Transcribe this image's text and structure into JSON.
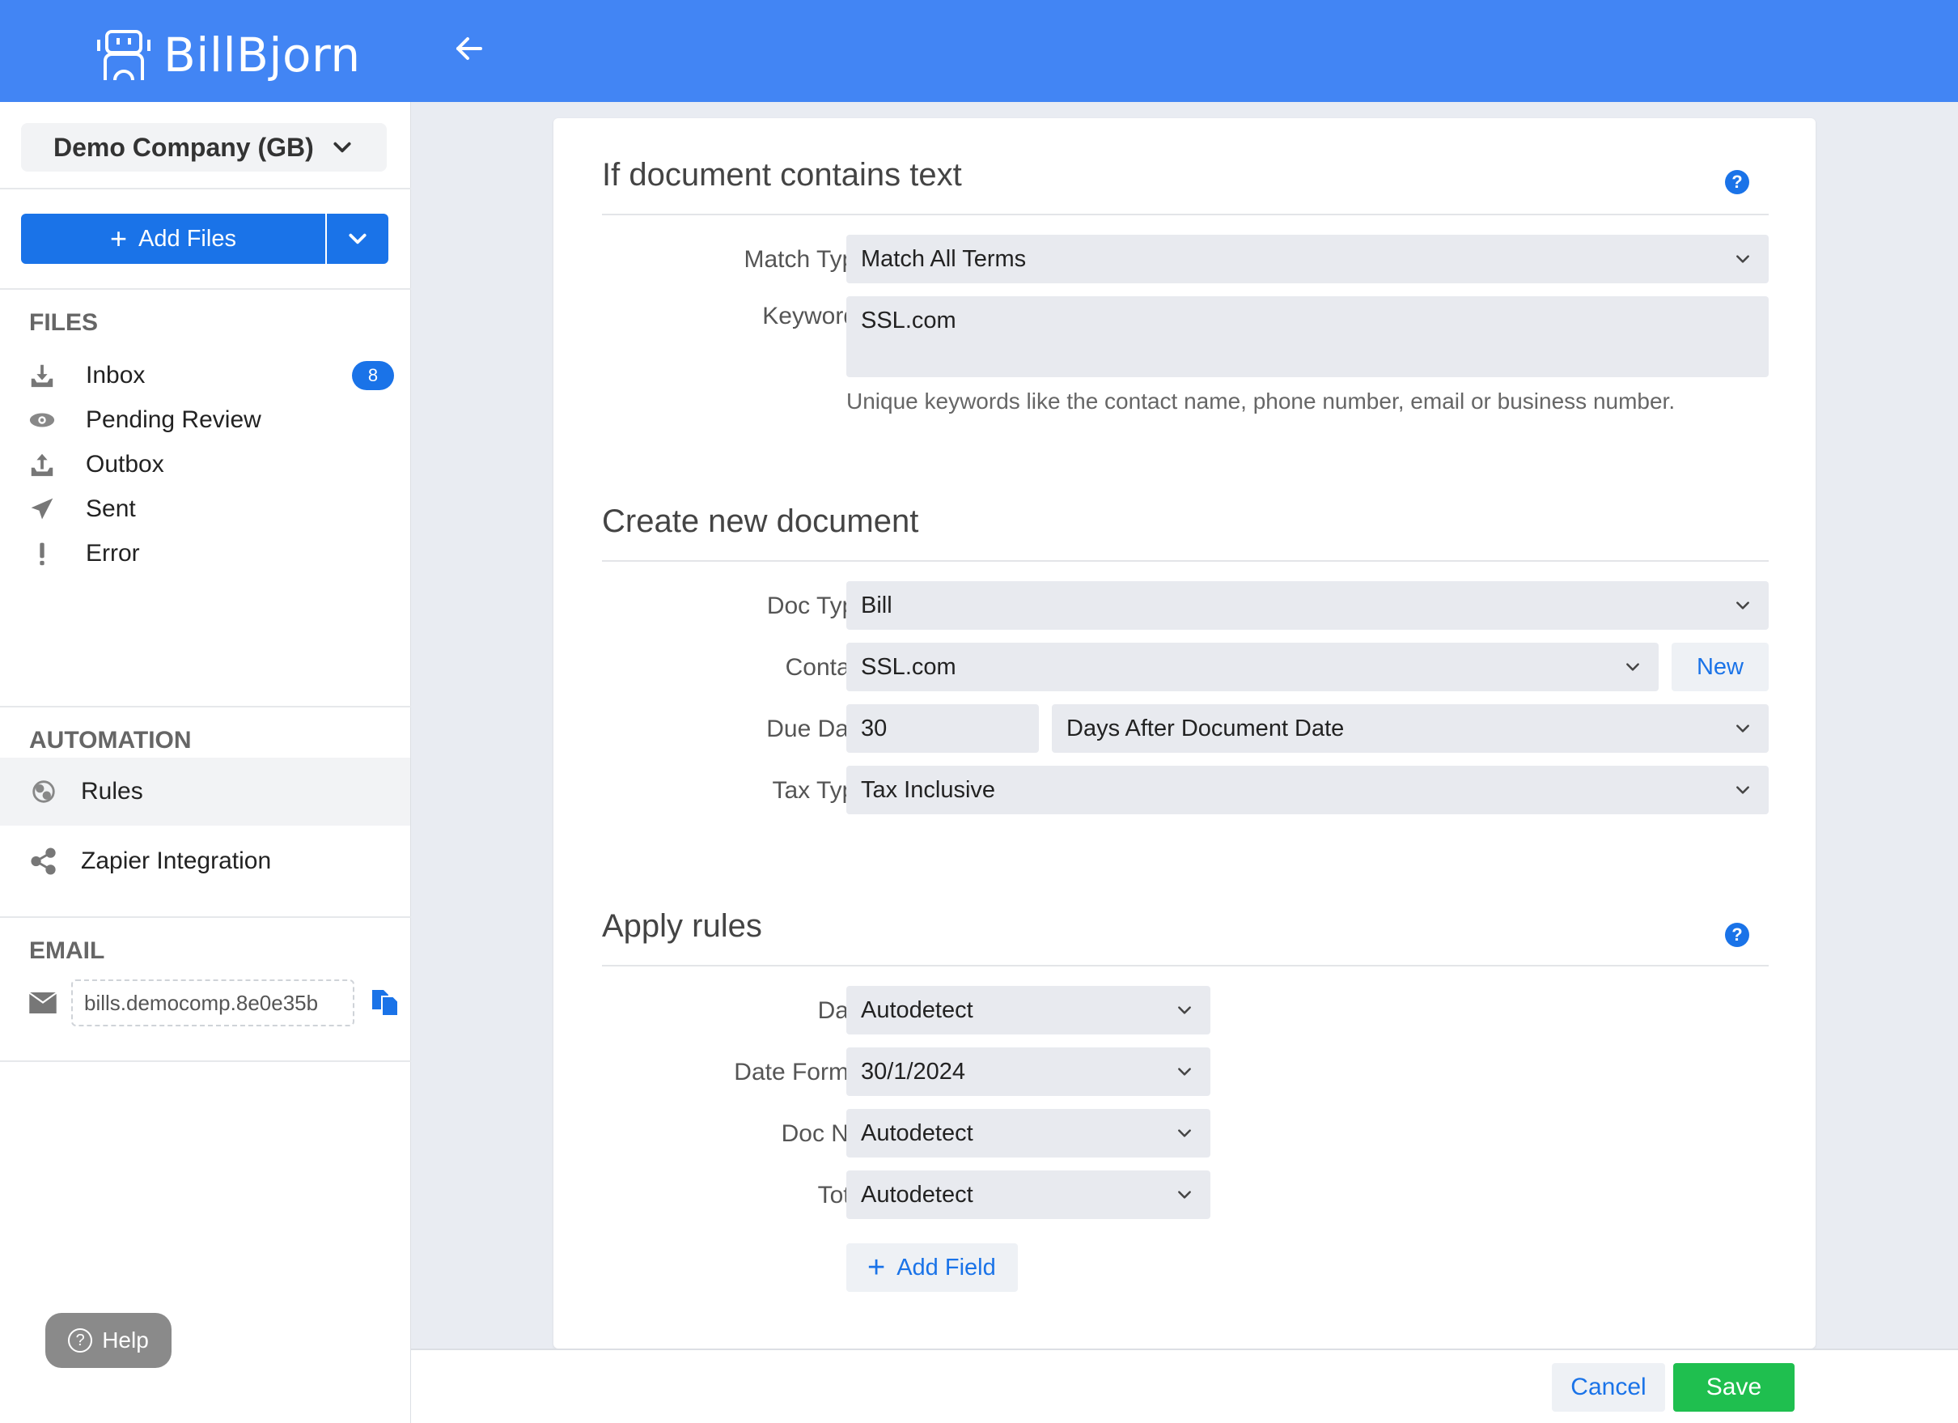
{
  "app": {
    "name": "BillBjorn",
    "accent": "#4285f4",
    "primary": "#1a73e8",
    "success": "#1fbf4f"
  },
  "sidebar": {
    "company": "Demo Company (GB)",
    "add_files": "Add Files",
    "files_title": "FILES",
    "files": [
      {
        "label": "Inbox",
        "icon": "inbox-icon",
        "badge": "8"
      },
      {
        "label": "Pending Review",
        "icon": "eye-icon"
      },
      {
        "label": "Outbox",
        "icon": "outbox-icon"
      },
      {
        "label": "Sent",
        "icon": "paper-plane-icon"
      },
      {
        "label": "Error",
        "icon": "exclamation-icon"
      }
    ],
    "automation_title": "AUTOMATION",
    "automation": [
      {
        "label": "Rules",
        "icon": "gears-icon",
        "active": true
      },
      {
        "label": "Zapier Integration",
        "icon": "share-icon"
      }
    ],
    "email_title": "EMAIL",
    "email_address": "bills.democomp.8e0e35b",
    "help": "Help"
  },
  "rule": {
    "section1": {
      "title": "If document contains text",
      "match_type_label": "Match Type",
      "match_type": "Match All Terms",
      "keywords_label": "Keywords",
      "keywords": "SSL.com",
      "keywords_hint": "Unique keywords like the contact name, phone number, email or business number."
    },
    "section2": {
      "title": "Create new document",
      "doc_type_label": "Doc Type",
      "doc_type": "Bill",
      "contact_label": "Contact",
      "contact": "SSL.com",
      "new_label": "New",
      "due_date_label": "Due Date",
      "due_days": "30",
      "due_mode": "Days After Document Date",
      "tax_type_label": "Tax Type",
      "tax_type": "Tax Inclusive"
    },
    "section3": {
      "title": "Apply rules",
      "date_label": "Date",
      "date": "Autodetect",
      "date_format_label": "Date Format",
      "date_format": "30/1/2024",
      "doc_no_label": "Doc No.",
      "doc_no": "Autodetect",
      "total_label": "Total",
      "total": "Autodetect",
      "add_field": "Add Field"
    }
  },
  "footer": {
    "cancel": "Cancel",
    "save": "Save"
  }
}
